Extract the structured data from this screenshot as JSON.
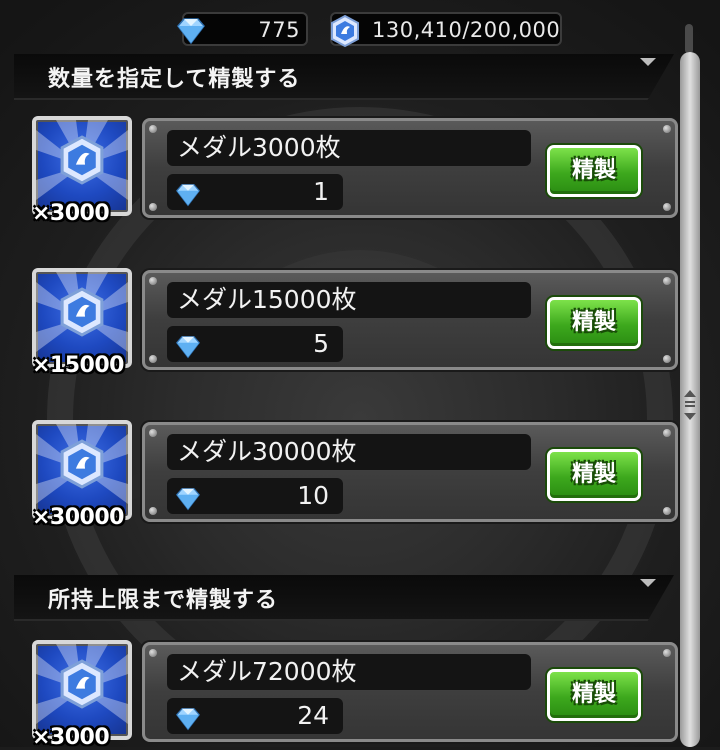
{
  "currency": {
    "gems_value": "775",
    "medals_value": "130,410/200,000",
    "gem_icon": "diamond-icon",
    "medal_icon": "medal-icon"
  },
  "sections": [
    {
      "title": "数量を指定して精製する"
    },
    {
      "title": "所持上限まで精製する"
    }
  ],
  "items": [
    {
      "count_label": "×3000",
      "name": "メダル3000枚",
      "cost": "1",
      "button_label": "精製"
    },
    {
      "count_label": "×15000",
      "name": "メダル15000枚",
      "cost": "5",
      "button_label": "精製"
    },
    {
      "count_label": "×30000",
      "name": "メダル30000枚",
      "cost": "10",
      "button_label": "精製"
    },
    {
      "count_label": "×3000",
      "name": "メダル72000枚",
      "cost": "24",
      "button_label": "精製"
    }
  ],
  "colors": {
    "button_green": "#3da81d",
    "tile_blue": "#1e49c0",
    "panel_gray": "#3e3e3e"
  }
}
